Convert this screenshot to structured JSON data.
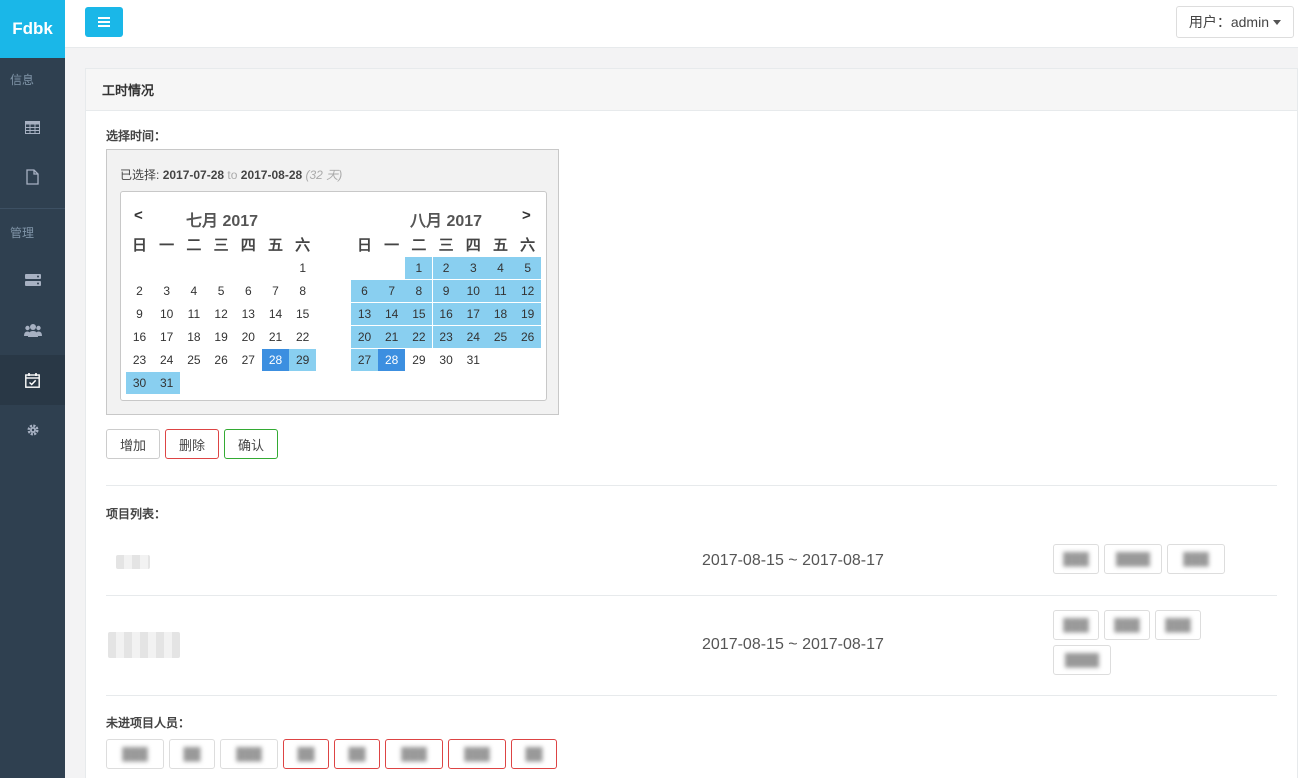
{
  "brand": "Fdbk",
  "sidebar": {
    "section_info": "信息",
    "section_manage": "管理"
  },
  "topbar": {
    "user_label": "用户：admin"
  },
  "panel": {
    "title": "工时情况",
    "select_time_label": "选择时间：",
    "selection": {
      "prefix": "已选择:",
      "start": "2017-07-28",
      "to": "to",
      "end": "2017-08-28",
      "days": "(32 天)"
    },
    "calendar": {
      "prev": "<",
      "next": ">",
      "left_title": "七月 2017",
      "right_title": "八月 2017",
      "weekdays": [
        "日",
        "一",
        "二",
        "三",
        "四",
        "五",
        "六"
      ]
    },
    "buttons": {
      "add": "增加",
      "delete": "删除",
      "confirm": "确认"
    },
    "project_list_label": "项目列表：",
    "projects": [
      {
        "name": "███",
        "date_range": "2017-08-15 ~ 2017-08-17",
        "members": [
          "███",
          "████",
          "███"
        ]
      },
      {
        "name": "█████",
        "date_range": "2017-08-15 ~ 2017-08-17",
        "members": [
          "███",
          "███",
          "███",
          "████"
        ]
      }
    ],
    "not_in_project_label": "未进项目人员：",
    "people": [
      "███",
      "██",
      "███",
      "██",
      "██",
      "███",
      "███",
      "██"
    ]
  }
}
